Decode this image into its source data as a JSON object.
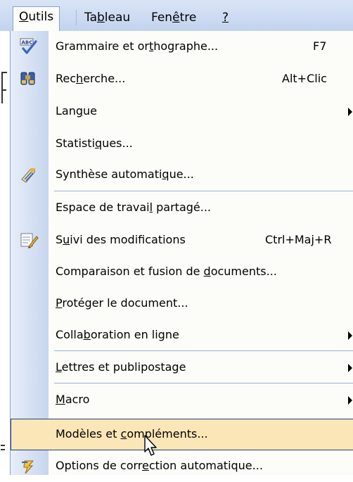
{
  "menubar": {
    "items": [
      {
        "pre": "",
        "acc": "O",
        "post": "utils"
      },
      {
        "pre": "Ta",
        "acc": "b",
        "post": "leau"
      },
      {
        "pre": "Fen",
        "acc": "ê",
        "post": "tre"
      },
      {
        "pre": "",
        "acc": "?",
        "post": ""
      }
    ]
  },
  "menu": {
    "items": [
      {
        "pre": "Grammaire et or",
        "acc": "t",
        "post": "hographe...",
        "shortcut": "F7",
        "icon": "spelling-abc-icon"
      },
      {
        "pre": "Rec",
        "acc": "h",
        "post": "erche...",
        "shortcut": "Alt+Clic",
        "icon": "research-binoculars-icon"
      },
      {
        "pre": "Lan",
        "acc": "g",
        "post": "ue",
        "submenu": true
      },
      {
        "pre": "Statisti",
        "acc": "q",
        "post": "ues..."
      },
      {
        "pre": "Synthèse automati",
        "acc": "q",
        "post": "ue...",
        "icon": "autosummarize-icon"
      },
      {
        "pre": "Espace de travai",
        "acc": "l",
        "post": " partagé..."
      },
      {
        "pre": "S",
        "acc": "u",
        "post": "ivi des modifications",
        "shortcut": "Ctrl+Maj+R",
        "icon": "track-changes-icon"
      },
      {
        "pre": "Comparaison et fusion de ",
        "acc": "d",
        "post": "ocuments..."
      },
      {
        "pre": "",
        "acc": "P",
        "post": "rotéger le document..."
      },
      {
        "pre": "Colla",
        "acc": "b",
        "post": "oration en ligne",
        "submenu": true
      },
      {
        "pre": "",
        "acc": "L",
        "post": "ettres et publipostage",
        "submenu": true
      },
      {
        "pre": "",
        "acc": "M",
        "post": "acro",
        "submenu": true
      },
      {
        "pre": "Modèles et ",
        "acc": "c",
        "post": "ompléments..."
      },
      {
        "pre": "Options de corr",
        "acc": "e",
        "post": "ction automatique...",
        "icon": "autocorrect-lightning-icon"
      }
    ]
  },
  "colors": {
    "menubar": "#c3d3ef",
    "highlight": "#fbe6b7",
    "highlight_border": "#203f7c",
    "icon_strip": "#c7d6ee"
  }
}
